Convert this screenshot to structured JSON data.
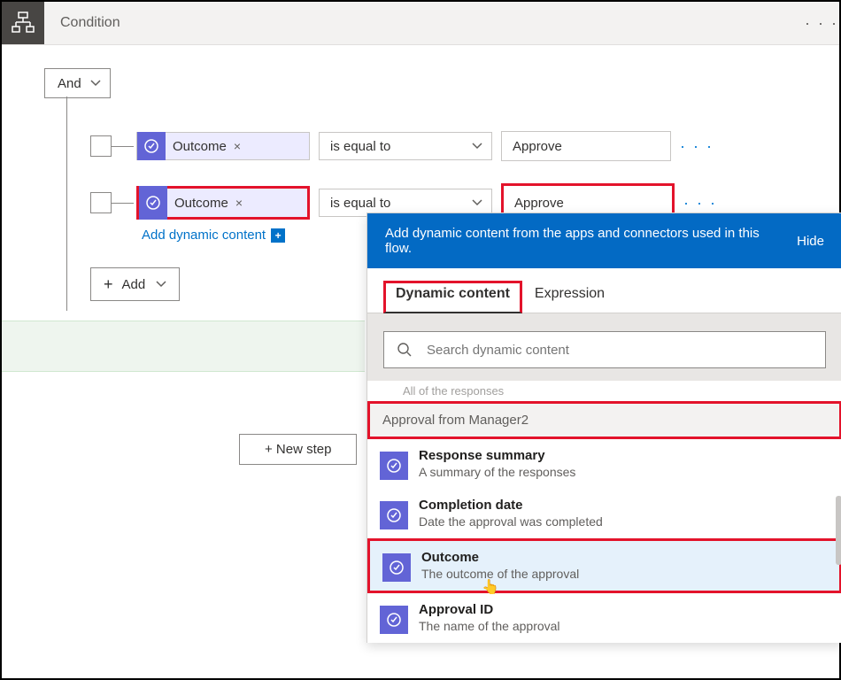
{
  "header": {
    "title": "Condition",
    "more": "· · ·"
  },
  "logic": {
    "group_op": "And",
    "add_dynamic_label": "Add dynamic content",
    "add_row_label": "Add",
    "rows": [
      {
        "token": "Outcome",
        "operator": "is equal to",
        "value": "Approve"
      },
      {
        "token": "Outcome",
        "operator": "is equal to",
        "value": "Approve"
      }
    ]
  },
  "new_step_label": "+ New step",
  "dc": {
    "banner_text": "Add dynamic content from the apps and connectors used in this flow.",
    "hide_label": "Hide",
    "tabs": {
      "dynamic": "Dynamic content",
      "expression": "Expression"
    },
    "search_placeholder": "Search dynamic content",
    "clipped_label": "All of the responses",
    "section_header": "Approval from Manager2",
    "items": [
      {
        "title": "Response summary",
        "desc": "A summary of the responses"
      },
      {
        "title": "Completion date",
        "desc": "Date the approval was completed"
      },
      {
        "title": "Outcome",
        "desc": "The outcome of the approval"
      },
      {
        "title": "Approval ID",
        "desc": "The name of the approval"
      }
    ]
  }
}
